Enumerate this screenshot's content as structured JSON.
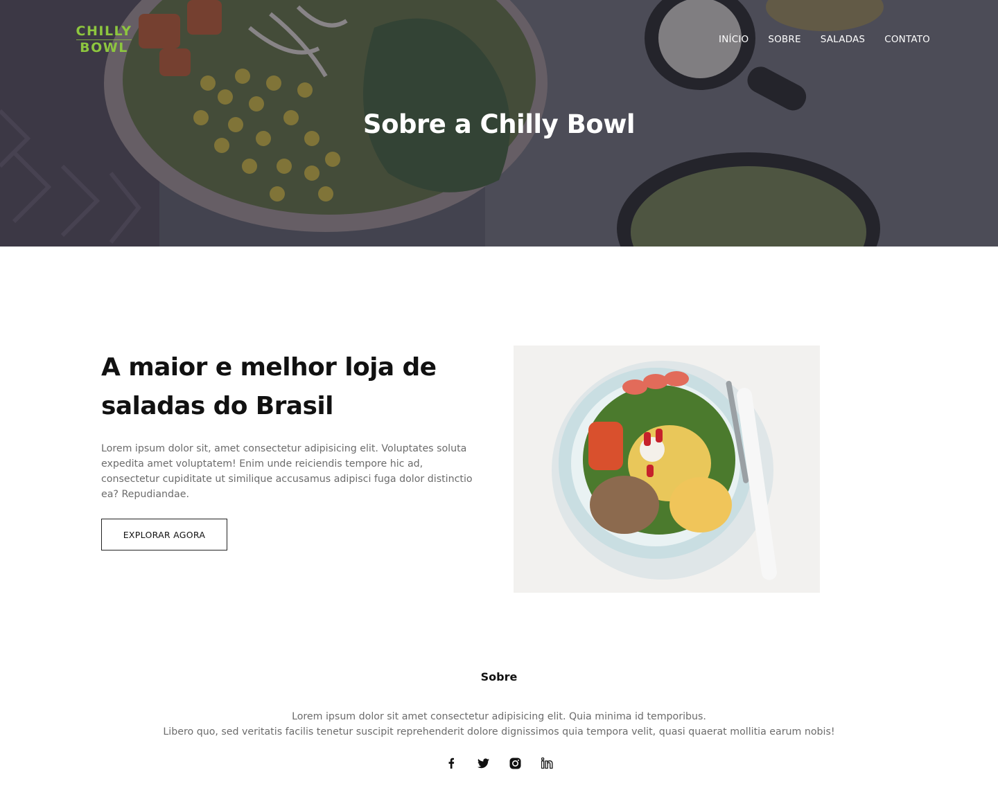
{
  "header": {
    "logo_top": "CHILLY",
    "logo_bottom": "BOWL",
    "nav": [
      "INÍCIO",
      "SOBRE",
      "SALADAS",
      "CONTATO"
    ],
    "hero_title": "Sobre a Chilly Bowl"
  },
  "about": {
    "title": "A maior e melhor loja de saladas do Brasil",
    "description": "Lorem ipsum dolor sit, amet consectetur adipisicing elit. Voluptates soluta expedita amet voluptatem! Enim unde reiciendis tempore hic ad, consectetur cupiditate ut similique accusamus adipisci fuga dolor distinctio ea? Repudiandae.",
    "button_label": "EXPLORAR AGORA"
  },
  "footer": {
    "title": "Sobre",
    "line1": "Lorem ipsum dolor sit amet consectetur adipisicing elit. Quia minima id temporibus.",
    "line2": "Libero quo, sed veritatis facilis tenetur suscipit reprehenderit dolore dignissimos quia tempora velit, quasi quaerat mollitia earum nobis!",
    "social_icons": [
      "facebook-icon",
      "twitter-icon",
      "instagram-icon",
      "linkedin-icon"
    ]
  },
  "colors": {
    "brand_green": "#8dc63f",
    "hero_overlay": "#2e2e3a",
    "body_text": "#6b6b6b"
  }
}
